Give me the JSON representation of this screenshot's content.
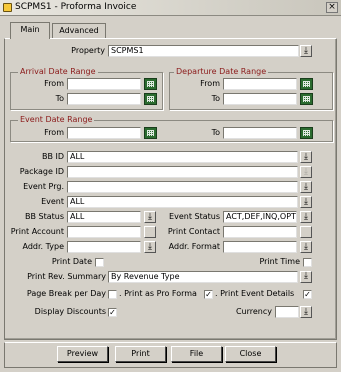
{
  "window": {
    "title": "SCPMS1 - Proforma Invoice",
    "close_glyph": "×"
  },
  "tabs": [
    {
      "label": "Main",
      "active": true
    },
    {
      "label": "Advanced",
      "active": false
    }
  ],
  "property": {
    "label": "Property",
    "value": "SCPMS1"
  },
  "arrival": {
    "title": "Arrival Date Range",
    "from_label": "From",
    "to_label": "To",
    "from_value": "",
    "to_value": ""
  },
  "departure": {
    "title": "Departure Date Range",
    "from_label": "From",
    "to_label": "To",
    "from_value": "",
    "to_value": ""
  },
  "event_range": {
    "title": "Event Date Range",
    "from_label": "From",
    "to_label": "To",
    "from_value": "",
    "to_value": ""
  },
  "fields": {
    "bb_id": {
      "label": "BB ID",
      "value": "ALL"
    },
    "package_id": {
      "label": "Package ID",
      "value": ""
    },
    "event_prg": {
      "label": "Event Prg.",
      "value": ""
    },
    "event": {
      "label": "Event",
      "value": "ALL"
    },
    "bb_status": {
      "label": "BB  Status",
      "value": "ALL"
    },
    "event_status": {
      "label": "Event Status",
      "value": "ACT,DEF,INQ,OPT"
    },
    "print_account": {
      "label": "Print Account",
      "value": ""
    },
    "print_contact": {
      "label": "Print Contact",
      "value": ""
    },
    "addr_type": {
      "label": "Addr. Type",
      "value": ""
    },
    "addr_format": {
      "label": "Addr. Format",
      "value": ""
    },
    "print_rev_summary": {
      "label": "Print Rev. Summary",
      "value": "By Revenue Type"
    },
    "currency": {
      "label": "Currency",
      "value": ""
    }
  },
  "checks": {
    "print_date": {
      "label": "Print Date",
      "checked": false
    },
    "print_time": {
      "label": "Print Time",
      "checked": false
    },
    "page_break": {
      "label": "Page Break per Day",
      "checked": false
    },
    "print_pro_forma": {
      "label": ". Print as Pro Forma",
      "checked": true
    },
    "print_event_details": {
      "label": ". Print Event Details",
      "checked": true
    },
    "display_discounts": {
      "label": "Display Discounts",
      "checked": true
    }
  },
  "buttons": {
    "preview": "Preview",
    "print": "Print",
    "file": "File",
    "close": "Close"
  },
  "colors": {
    "group_title": "#8b1a1a",
    "background": "#d4d0c8",
    "calendar": "#2b6b2f"
  }
}
